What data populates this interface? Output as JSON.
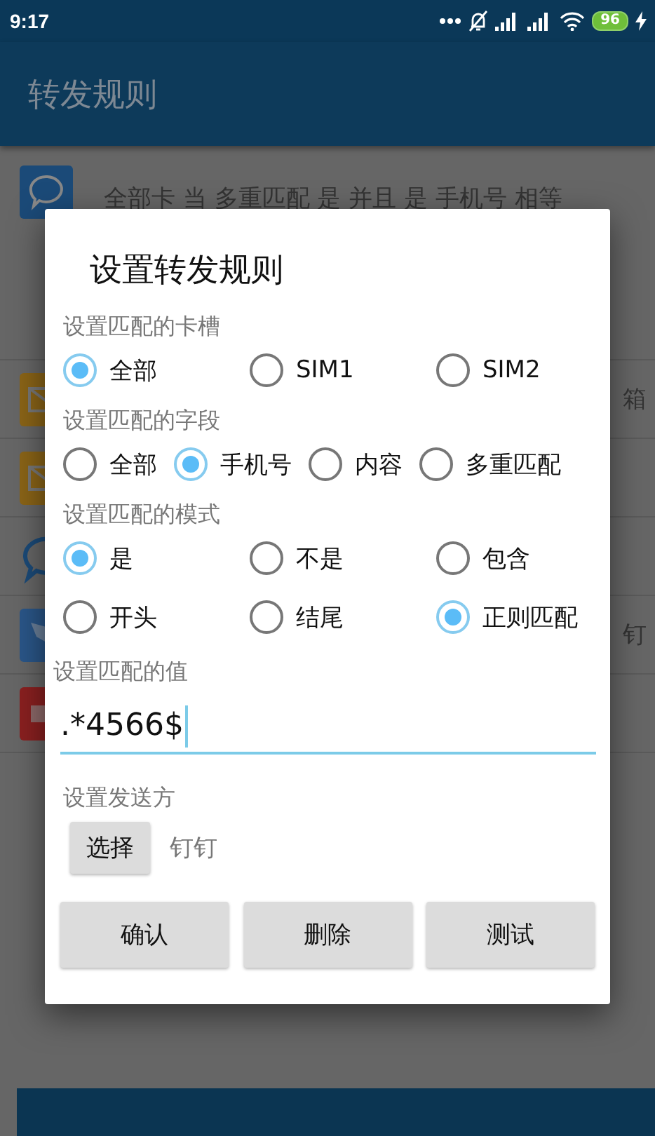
{
  "status_bar": {
    "time": "9:17",
    "battery": "96"
  },
  "app_bar": {
    "title": "转发规则"
  },
  "background_rows": [
    {
      "kind": "chat",
      "text": "全部卡 当 多重匹配 是 并且 是 手机号 相等"
    },
    {
      "kind": "mail",
      "text": "箱"
    },
    {
      "kind": "mail"
    },
    {
      "kind": "chat-outline"
    },
    {
      "kind": "wing",
      "text": "钉"
    },
    {
      "kind": "video"
    }
  ],
  "dialog": {
    "title": "设置转发规则",
    "card_slot": {
      "label": "设置匹配的卡槽",
      "options": [
        {
          "label": "全部",
          "selected": true
        },
        {
          "label": "SIM1",
          "selected": false
        },
        {
          "label": "SIM2",
          "selected": false
        }
      ]
    },
    "field": {
      "label": "设置匹配的字段",
      "options": [
        {
          "label": "全部",
          "selected": false
        },
        {
          "label": "手机号",
          "selected": true
        },
        {
          "label": "内容",
          "selected": false
        },
        {
          "label": "多重匹配",
          "selected": false
        }
      ]
    },
    "mode": {
      "label": "设置匹配的模式",
      "options": [
        {
          "label": "是",
          "selected": true
        },
        {
          "label": "不是",
          "selected": false
        },
        {
          "label": "包含",
          "selected": false
        },
        {
          "label": "开头",
          "selected": false
        },
        {
          "label": "结尾",
          "selected": false
        },
        {
          "label": "正则匹配",
          "selected": true
        }
      ]
    },
    "value": {
      "label": "设置匹配的值",
      "value": ".*4566$"
    },
    "sender": {
      "label": "设置发送方",
      "button": "选择",
      "value": "钉钉"
    },
    "buttons": [
      "确认",
      "删除",
      "测试"
    ]
  }
}
